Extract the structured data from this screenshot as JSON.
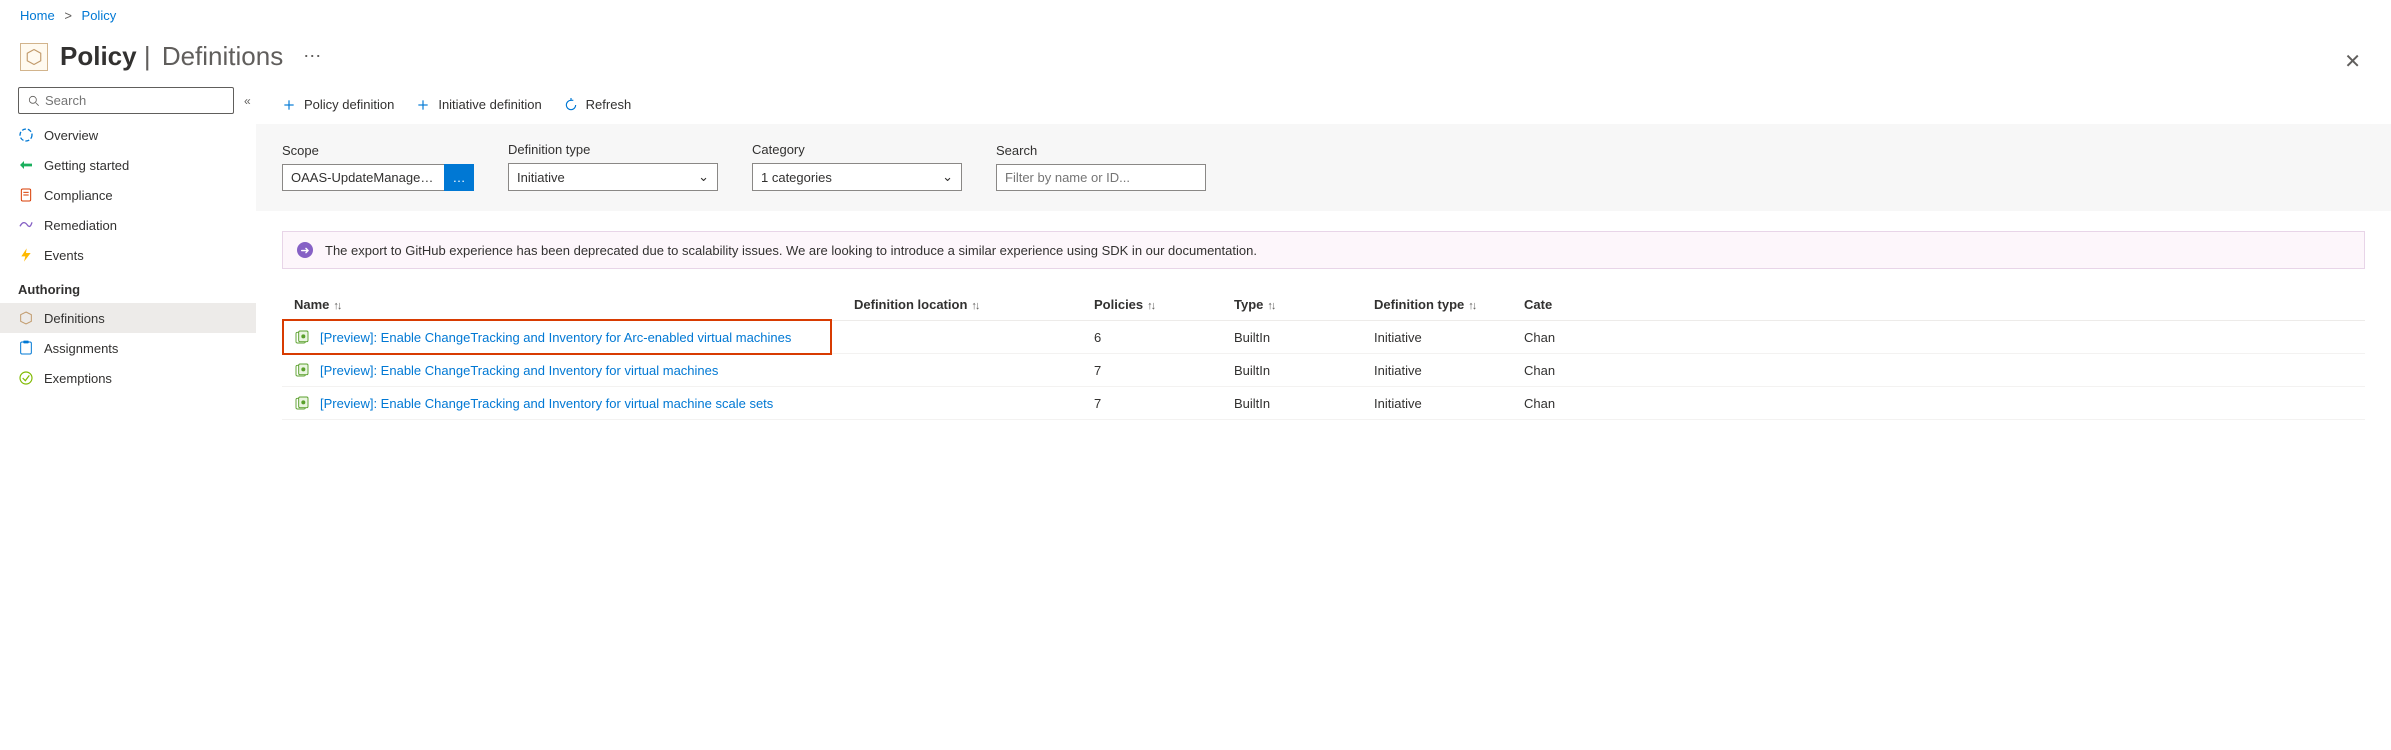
{
  "breadcrumb": {
    "home": "Home",
    "current": "Policy"
  },
  "header": {
    "title": "Policy",
    "subtitle": "Definitions"
  },
  "sidebar": {
    "search_placeholder": "Search",
    "items": [
      {
        "label": "Overview"
      },
      {
        "label": "Getting started"
      },
      {
        "label": "Compliance"
      },
      {
        "label": "Remediation"
      },
      {
        "label": "Events"
      }
    ],
    "authoring_label": "Authoring",
    "authoring": [
      {
        "label": "Definitions"
      },
      {
        "label": "Assignments"
      },
      {
        "label": "Exemptions"
      }
    ]
  },
  "toolbar": {
    "policy_def": "Policy definition",
    "initiative_def": "Initiative definition",
    "refresh": "Refresh"
  },
  "filters": {
    "scope_label": "Scope",
    "scope_value": "OAAS-UpdateManagem…",
    "deftype_label": "Definition type",
    "deftype_value": "Initiative",
    "category_label": "Category",
    "category_value": "1 categories",
    "search_label": "Search",
    "search_placeholder": "Filter by name or ID..."
  },
  "info_message": "The export to GitHub experience has been deprecated due to scalability issues. We are looking to introduce a similar experience using SDK in our documentation.",
  "table": {
    "headers": {
      "name": "Name",
      "definition_location": "Definition location",
      "policies": "Policies",
      "type": "Type",
      "definition_type": "Definition type",
      "category": "Cate"
    },
    "rows": [
      {
        "name": "[Preview]: Enable ChangeTracking and Inventory for Arc-enabled virtual machines",
        "definition_location": "",
        "policies": "6",
        "type": "BuiltIn",
        "definition_type": "Initiative",
        "category": "Chan",
        "highlight": true
      },
      {
        "name": "[Preview]: Enable ChangeTracking and Inventory for virtual machines",
        "definition_location": "",
        "policies": "7",
        "type": "BuiltIn",
        "definition_type": "Initiative",
        "category": "Chan",
        "highlight": false
      },
      {
        "name": "[Preview]: Enable ChangeTracking and Inventory for virtual machine scale sets",
        "definition_location": "",
        "policies": "7",
        "type": "BuiltIn",
        "definition_type": "Initiative",
        "category": "Chan",
        "highlight": false
      }
    ]
  }
}
